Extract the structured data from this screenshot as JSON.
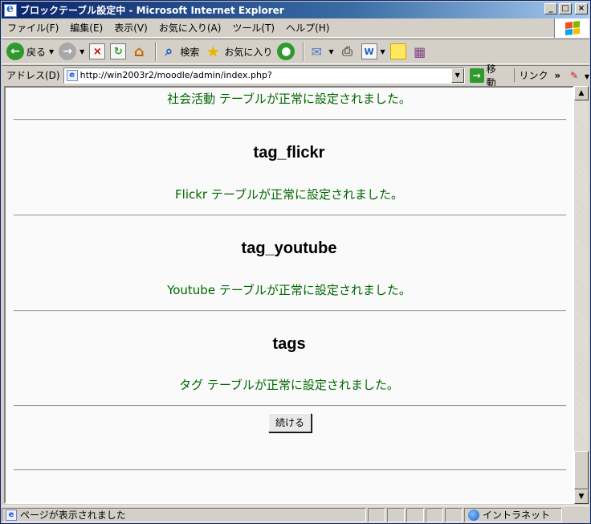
{
  "window": {
    "title": "ブロックテーブル設定中 - Microsoft Internet Explorer",
    "minimize_label": "_",
    "maximize_label": "□",
    "close_label": "×"
  },
  "menu": [
    "ファイル(F)",
    "編集(E)",
    "表示(V)",
    "お気に入り(A)",
    "ツール(T)",
    "ヘルプ(H)"
  ],
  "toolbar": {
    "back_label": "戻る",
    "search_label": "検索",
    "favorites_label": "お気に入り",
    "word_label": "W"
  },
  "address": {
    "label": "アドレス(D)",
    "url": "http://win2003r2/moodle/admin/index.php?",
    "go_label": "移動",
    "links_label": "リンク",
    "links_chevron": "»"
  },
  "content": {
    "top_message": "社会活動 テーブルが正常に設定されました。",
    "sections": [
      {
        "heading": "tag_flickr",
        "message": "Flickr テーブルが正常に設定されました。"
      },
      {
        "heading": "tag_youtube",
        "message": "Youtube テーブルが正常に設定されました。"
      },
      {
        "heading": "tags",
        "message": "タグ テーブルが正常に設定されました。"
      }
    ],
    "continue_label": "続ける"
  },
  "status": {
    "text": "ページが表示されました",
    "zone": "イントラネット"
  },
  "colors": {
    "message_green": "#006600",
    "title_bar": "#0a246a"
  }
}
